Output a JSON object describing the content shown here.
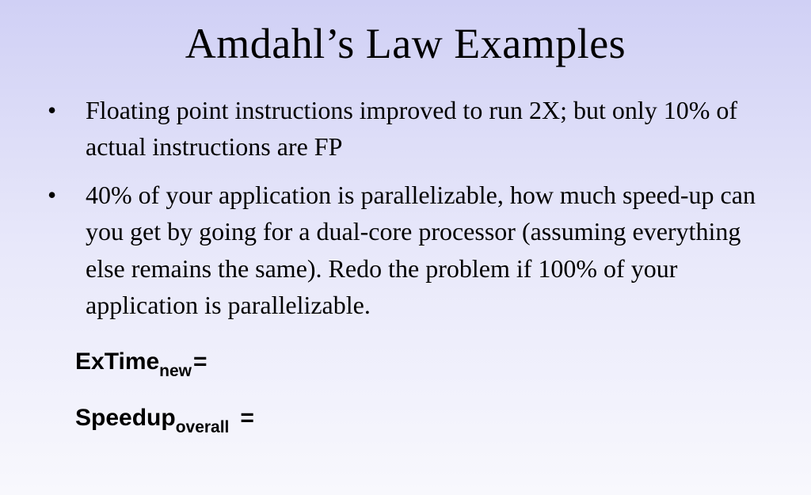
{
  "slide": {
    "title": "Amdahl’s Law Examples",
    "bullets": [
      "Floating point instructions improved to run 2X; but only 10% of actual instructions are FP",
      "40% of your application is parallelizable, how much speed-up can you get by going for a dual-core processor (assuming everything else remains the same). Redo the problem if 100% of your application is parallelizable."
    ],
    "formulas": {
      "extime_main": "ExTime",
      "extime_sub": "new",
      "extime_eq": "=",
      "speedup_main": "Speedup",
      "speedup_sub": "overall",
      "speedup_eq": "="
    }
  }
}
